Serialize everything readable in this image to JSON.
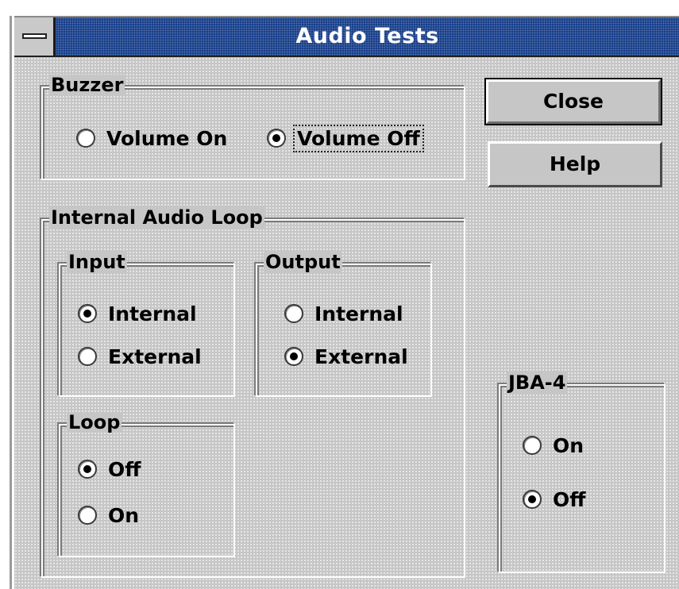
{
  "window": {
    "title": "Audio Tests"
  },
  "buzzer": {
    "label": "Buzzer",
    "options": [
      {
        "label": "Volume On",
        "checked": false
      },
      {
        "label": "Volume Off",
        "checked": true
      }
    ]
  },
  "buttons": {
    "close": "Close",
    "help": "Help"
  },
  "internal_audio_loop": {
    "label": "Internal Audio Loop",
    "input": {
      "label": "Input",
      "options": [
        {
          "label": "Internal",
          "checked": true
        },
        {
          "label": "External",
          "checked": false
        }
      ]
    },
    "output": {
      "label": "Output",
      "options": [
        {
          "label": "Internal",
          "checked": false
        },
        {
          "label": "External",
          "checked": true
        }
      ]
    },
    "loop": {
      "label": "Loop",
      "options": [
        {
          "label": "Off",
          "checked": true
        },
        {
          "label": "On",
          "checked": false
        }
      ]
    }
  },
  "jba4": {
    "label": "JBA-4",
    "options": [
      {
        "label": "On",
        "checked": false
      },
      {
        "label": "Off",
        "checked": true
      }
    ]
  }
}
